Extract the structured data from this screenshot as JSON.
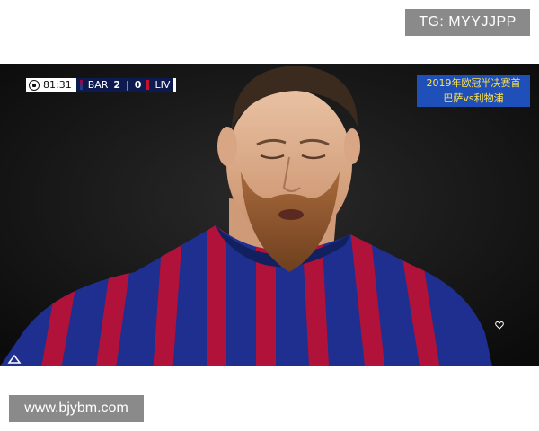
{
  "watermark_top": "TG: MYYJJPP",
  "watermark_bottom": "www.bjybm.com",
  "scoreboard": {
    "clock": "81:31",
    "home_team": "BAR",
    "home_score": "2",
    "away_score": "0",
    "away_team": "LIV"
  },
  "caption": {
    "line1": "2019年欧冠半决赛首",
    "line2": "巴萨vs利物浦"
  },
  "icons": [
    "soccer-ball-icon",
    "heart-icon",
    "broadcaster-logo-icon"
  ],
  "colors": {
    "jersey_blue": "#1e2f8f",
    "jersey_red": "#b0123a",
    "caption_bg": "#1f4fb8",
    "caption_text": "#ffe14a",
    "badge_bg": "#8a8a8a"
  }
}
